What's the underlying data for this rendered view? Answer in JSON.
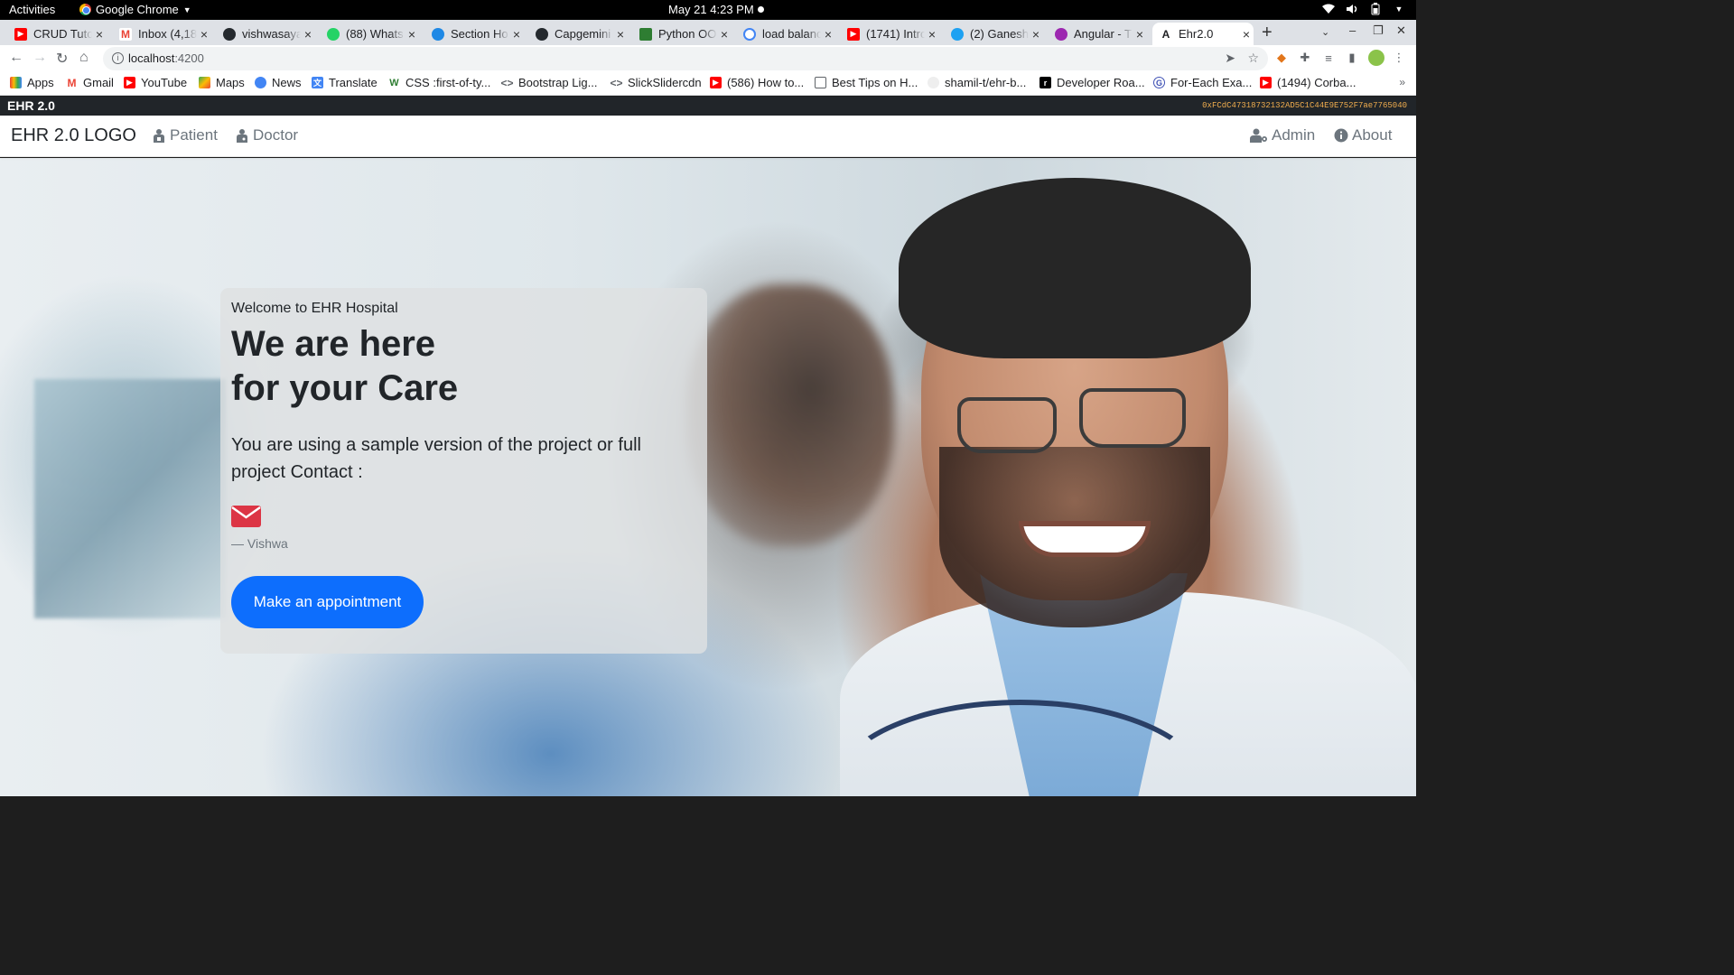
{
  "os": {
    "activities": "Activities",
    "app_menu": "Google Chrome",
    "clock": "May 21  4:23 PM"
  },
  "tabs": [
    {
      "title": "CRUD Tuto",
      "icon": "youtube-icon",
      "color": "#ff0000"
    },
    {
      "title": "Inbox (4,18",
      "icon": "gmail-icon",
      "color": "#ea4335"
    },
    {
      "title": "vishwasaya",
      "icon": "github-icon",
      "color": "#24292e"
    },
    {
      "title": "(88) Whats",
      "icon": "whatsapp-icon",
      "color": "#25d366"
    },
    {
      "title": "Section Ho",
      "icon": "site-icon",
      "color": "#1e88e5"
    },
    {
      "title": "Capgemini",
      "icon": "github-icon",
      "color": "#24292e"
    },
    {
      "title": "Python OO",
      "icon": "site-icon",
      "color": "#2e7d32"
    },
    {
      "title": "load balanc",
      "icon": "google-icon",
      "color": "#4285f4"
    },
    {
      "title": "(1741) Intro",
      "icon": "youtube-icon",
      "color": "#ff0000"
    },
    {
      "title": "(2) Ganesh",
      "icon": "twitter-icon",
      "color": "#1da1f2"
    },
    {
      "title": "Angular - T",
      "icon": "site-icon",
      "color": "#9c27b0"
    },
    {
      "title": "Ehr2.0",
      "icon": "angular-icon",
      "color": "#202124"
    }
  ],
  "address_bar": {
    "host": "localhost",
    "port": ":4200"
  },
  "bookmarks": [
    {
      "label": "Apps",
      "icon": "apps-grid-icon",
      "color": "#4285f4"
    },
    {
      "label": "Gmail",
      "icon": "gmail-icon",
      "color": "#ea4335"
    },
    {
      "label": "YouTube",
      "icon": "youtube-icon",
      "color": "#ff0000"
    },
    {
      "label": "Maps",
      "icon": "maps-icon",
      "color": "#34a853"
    },
    {
      "label": "News",
      "icon": "news-icon",
      "color": "#4285f4"
    },
    {
      "label": "Translate",
      "icon": "translate-icon",
      "color": "#4285f4"
    },
    {
      "label": "CSS :first-of-ty...",
      "icon": "site-icon",
      "color": "#2e7d32"
    },
    {
      "label": "Bootstrap Lig...",
      "icon": "code-icon",
      "color": "#5f6368"
    },
    {
      "label": "SlickSlidercdn",
      "icon": "code-icon",
      "color": "#5f6368"
    },
    {
      "label": "(586) How to...",
      "icon": "youtube-icon",
      "color": "#ff0000"
    },
    {
      "label": "Best Tips on H...",
      "icon": "site-icon",
      "color": "#5f6368"
    },
    {
      "label": "shamil-t/ehr-b...",
      "icon": "github-icon",
      "color": "#24292e"
    },
    {
      "label": "Developer Roa...",
      "icon": "site-icon",
      "color": "#000000"
    },
    {
      "label": "For-Each Exa...",
      "icon": "site-icon",
      "color": "#3f51b5"
    },
    {
      "label": "(1494) Corba...",
      "icon": "youtube-icon",
      "color": "#ff0000"
    }
  ],
  "app_header": {
    "name": "EHR 2.0",
    "account": "0xFCdC47318732132AD5C1C44E9E752F7ae7765040"
  },
  "navbar": {
    "brand": "EHR 2.0 LOGO",
    "patient": "Patient",
    "doctor": "Doctor",
    "admin": "Admin",
    "about": "About"
  },
  "hero": {
    "eyebrow": "Welcome to EHR Hospital",
    "headline_line1": "We are here",
    "headline_line2": "for your Care",
    "lead": "You are using a sample version of the project or full project Contact :",
    "signature": "— Vishwa",
    "cta": "Make an appointment"
  },
  "colors": {
    "primary": "#0d6efd",
    "mail_icon": "#dc3545",
    "app_header_bg": "#212529",
    "wallet_text": "#f0ad4e"
  }
}
